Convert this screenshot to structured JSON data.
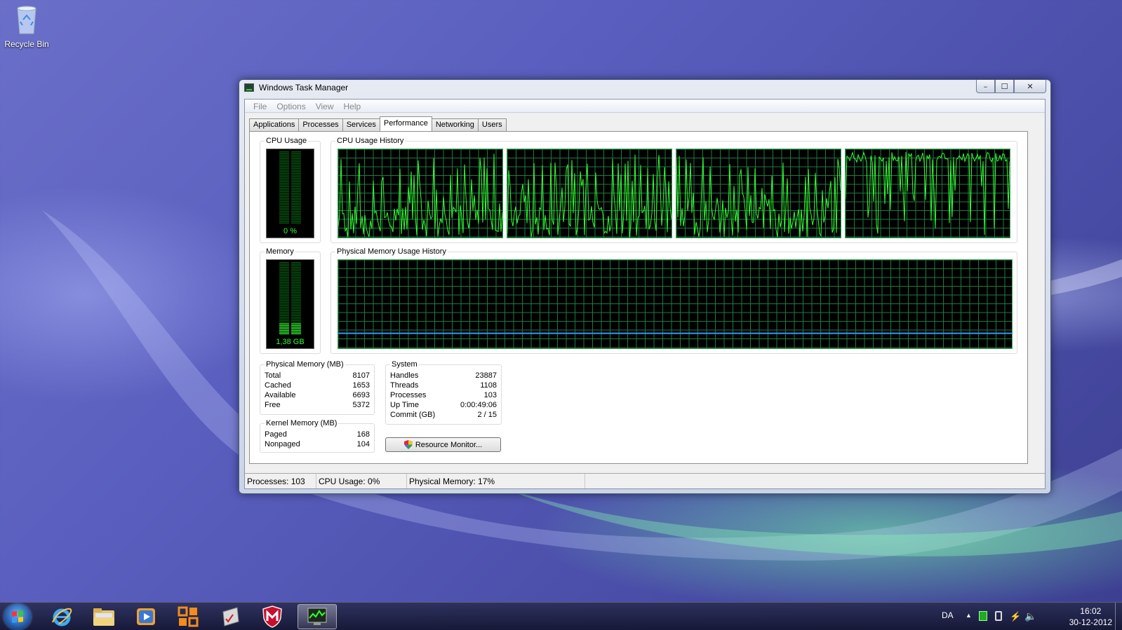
{
  "desktop": {
    "icons": [
      {
        "label": "Recycle Bin",
        "icon": "recycle-bin-icon"
      }
    ]
  },
  "window": {
    "title": "Windows Task Manager",
    "controls": {
      "minimize": "–",
      "maximize": "☐",
      "close": "✕"
    },
    "menu": [
      "File",
      "Options",
      "View",
      "Help"
    ],
    "tabs": [
      {
        "label": "Applications",
        "active": false
      },
      {
        "label": "Processes",
        "active": false
      },
      {
        "label": "Services",
        "active": false
      },
      {
        "label": "Performance",
        "active": true
      },
      {
        "label": "Networking",
        "active": false
      },
      {
        "label": "Users",
        "active": false
      }
    ],
    "performance": {
      "cpu_usage": {
        "label": "CPU Usage",
        "value": "0 %",
        "percent": 0
      },
      "cpu_history": {
        "label": "CPU Usage History",
        "cores": 4
      },
      "memory": {
        "label": "Memory",
        "value": "1,38 GB",
        "percent": 17
      },
      "memory_history": {
        "label": "Physical Memory Usage History",
        "percent": 17
      },
      "physical_memory": {
        "label": "Physical Memory (MB)",
        "rows": [
          {
            "name": "Total",
            "value": "8107"
          },
          {
            "name": "Cached",
            "value": "1653"
          },
          {
            "name": "Available",
            "value": "6693"
          },
          {
            "name": "Free",
            "value": "5372"
          }
        ]
      },
      "kernel_memory": {
        "label": "Kernel Memory (MB)",
        "rows": [
          {
            "name": "Paged",
            "value": "168"
          },
          {
            "name": "Nonpaged",
            "value": "104"
          }
        ]
      },
      "system": {
        "label": "System",
        "rows": [
          {
            "name": "Handles",
            "value": "23887"
          },
          {
            "name": "Threads",
            "value": "1108"
          },
          {
            "name": "Processes",
            "value": "103"
          },
          {
            "name": "Up Time",
            "value": "0:00:49:06"
          },
          {
            "name": "Commit (GB)",
            "value": "2 / 15"
          }
        ]
      },
      "resource_monitor_button": "Resource Monitor..."
    },
    "statusbar": {
      "processes": "Processes: 103",
      "cpu": "CPU Usage: 0%",
      "memory": "Physical Memory: 17%"
    }
  },
  "taskbar": {
    "pinned": [
      "internet-explorer-icon",
      "windows-explorer-icon",
      "media-player-icon",
      "office-icon",
      "notepad-icon",
      "mcafee-icon",
      "task-manager-icon"
    ],
    "active": "task-manager-icon",
    "tray": {
      "language": "DA",
      "time": "16:02",
      "date": "30-12-2012"
    }
  },
  "colors": {
    "graph_green": "#33ff33",
    "grid": "#1f7a3f",
    "memory_line": "#3399ff"
  }
}
